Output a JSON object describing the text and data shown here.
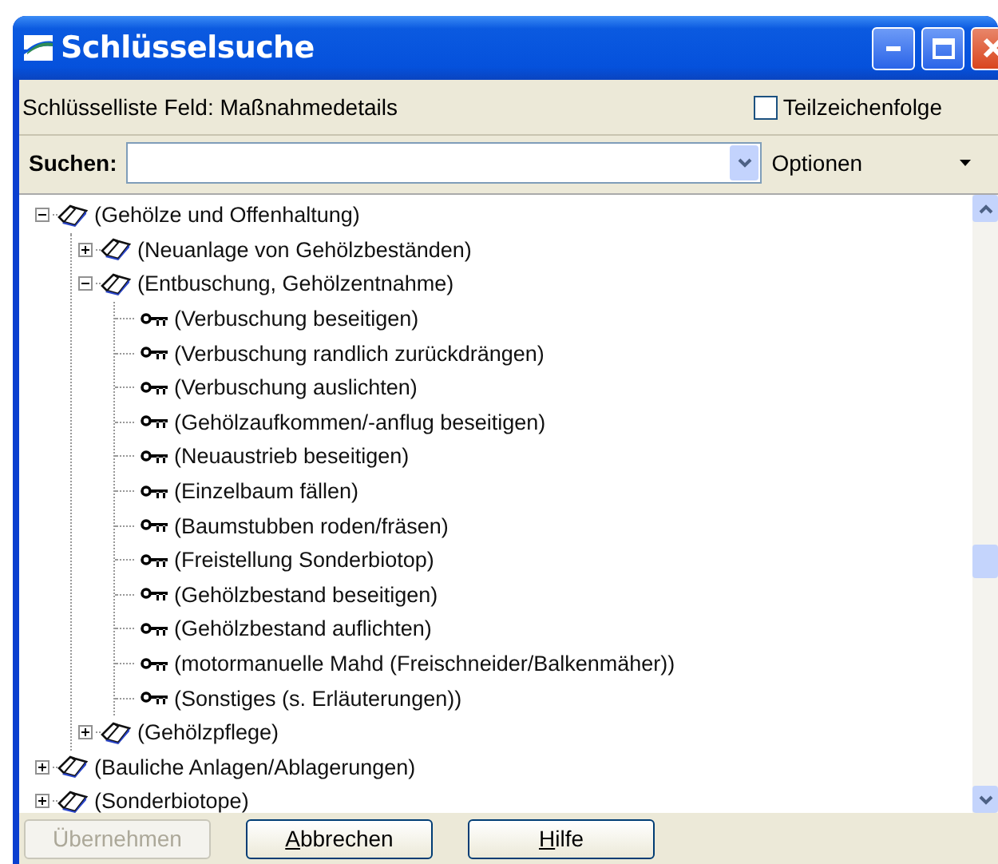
{
  "window": {
    "title": "Schlüsselsuche"
  },
  "info": {
    "label": "Schlüsselliste Feld: Maßnahmedetails",
    "substring_option": {
      "label": "Teilzeichenfolge",
      "checked": false
    }
  },
  "search": {
    "label": "Suchen:",
    "options_label": "Optionen"
  },
  "tree": [
    {
      "kind": "folder",
      "label": "(Gehölze und Offenhaltung)",
      "expanded": true,
      "children": [
        {
          "kind": "folder",
          "label": "(Neuanlage von Gehölzbeständen)",
          "expanded": false
        },
        {
          "kind": "folder",
          "label": "(Entbuschung, Gehölzentnahme)",
          "expanded": true,
          "children": [
            {
              "kind": "key",
              "label": "(Verbuschung beseitigen)"
            },
            {
              "kind": "key",
              "label": "(Verbuschung randlich zurückdrängen)"
            },
            {
              "kind": "key",
              "label": "(Verbuschung auslichten)"
            },
            {
              "kind": "key",
              "label": "(Gehölzaufkommen/-anflug beseitigen)"
            },
            {
              "kind": "key",
              "label": "(Neuaustrieb beseitigen)"
            },
            {
              "kind": "key",
              "label": "(Einzelbaum fällen)"
            },
            {
              "kind": "key",
              "label": "(Baumstubben roden/fräsen)"
            },
            {
              "kind": "key",
              "label": "(Freistellung Sonderbiotop)"
            },
            {
              "kind": "key",
              "label": "(Gehölzbestand beseitigen)"
            },
            {
              "kind": "key",
              "label": "(Gehölzbestand auflichten)"
            },
            {
              "kind": "key",
              "label": "(motormanuelle Mahd (Freischneider/Balkenmäher))"
            },
            {
              "kind": "key",
              "label": "(Sonstiges (s. Erläuterungen))"
            }
          ]
        },
        {
          "kind": "folder",
          "label": "(Gehölzpflege)",
          "expanded": false
        }
      ]
    },
    {
      "kind": "folder",
      "label": "(Bauliche Anlagen/Ablagerungen)",
      "expanded": false
    },
    {
      "kind": "folder",
      "label": "(Sonderbiotope)",
      "expanded": false
    }
  ],
  "buttons": [
    {
      "label": "Übernehmen",
      "disabled": true,
      "mnemonic": false
    },
    {
      "label": "Abbrechen",
      "disabled": false,
      "mnemonic": true
    },
    {
      "label": "Hilfe",
      "disabled": false,
      "mnemonic": true
    }
  ]
}
